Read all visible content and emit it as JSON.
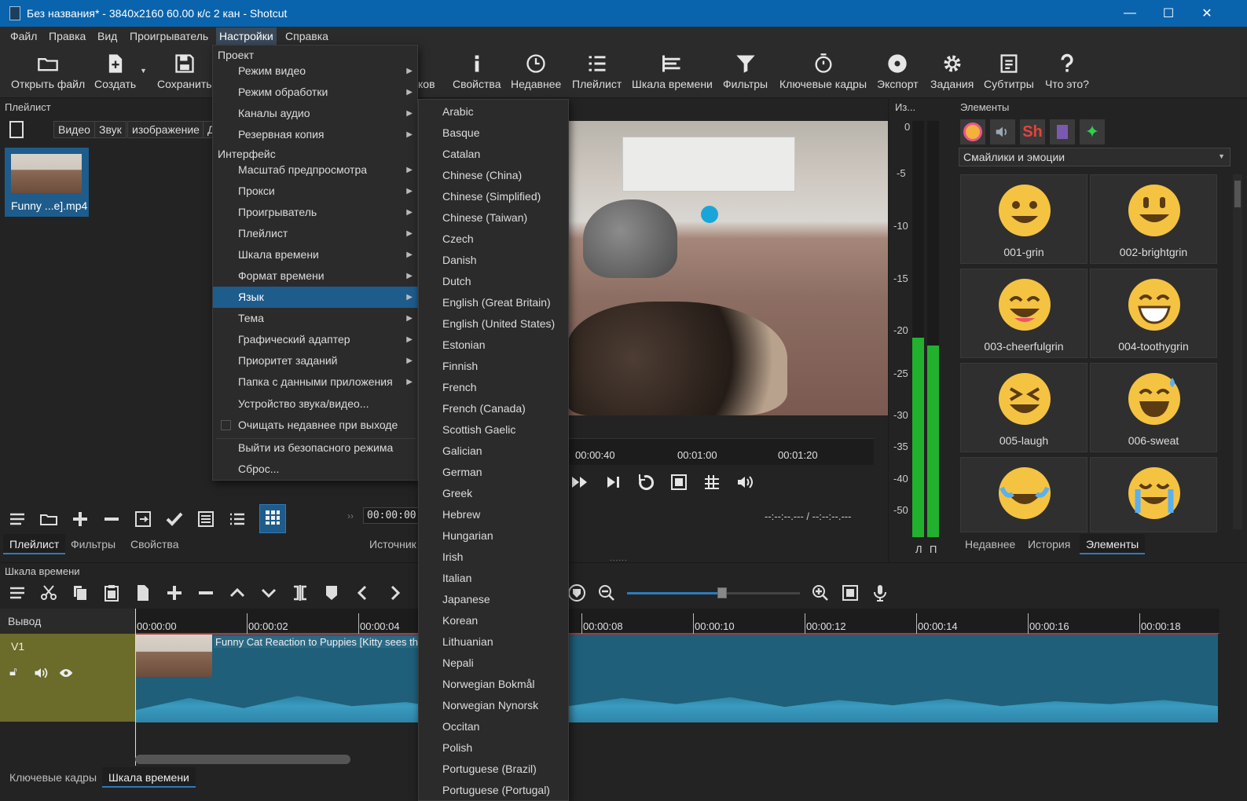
{
  "window": {
    "title": "Без названия* - 3840x2160 60.00 к/с 2 кан - Shotcut",
    "minimize": "—",
    "maximize": "☐",
    "close": "✕"
  },
  "menubar": [
    "Файл",
    "Правка",
    "Вид",
    "Проигрыватель",
    "Настройки",
    "Справка"
  ],
  "toolbar": {
    "open": "Открыть файл",
    "create": "Создать",
    "save": "Сохранить",
    "hidden_partial": "ков",
    "properties": "Свойства",
    "recent": "Недавнее",
    "playlist": "Плейлист",
    "timeline": "Шкала времени",
    "filters": "Фильтры",
    "keyframes": "Ключевые кадры",
    "export": "Экспорт",
    "jobs": "Задания",
    "subtitles": "Субтитры",
    "whatsthis": "Что это?"
  },
  "playlist": {
    "title": "Плейлист",
    "filters": [
      "Видео",
      "Звук",
      "изображение",
      "Д"
    ],
    "clip_label": "Funny ...e].mp4",
    "timecode": "00:00:00",
    "tabs": [
      "Плейлист",
      "Фильтры",
      "Свойства"
    ],
    "source_tab": "Источник"
  },
  "settings_menu": {
    "section_project": "Проект",
    "project_items": [
      "Режим видео",
      "Режим обработки",
      "Каналы аудио",
      "Резервная копия"
    ],
    "section_interface": "Интерфейс",
    "interface_items": [
      "Масштаб предпросмотра",
      "Прокси",
      "Проигрыватель",
      "Плейлист",
      "Шкала времени",
      "Формат времени",
      "Язык",
      "Тема",
      "Графический адаптер",
      "Приоритет заданий",
      "Папка с данными приложения"
    ],
    "device": "Устройство звука/видео...",
    "clear_recent": "Очищать недавнее при выходе",
    "safe_mode": "Выйти из безопасного режима",
    "reset": "Сброс..."
  },
  "languages": [
    "Arabic",
    "Basque",
    "Catalan",
    "Chinese (China)",
    "Chinese (Simplified)",
    "Chinese (Taiwan)",
    "Czech",
    "Danish",
    "Dutch",
    "English (Great Britain)",
    "English (United States)",
    "Estonian",
    "Finnish",
    "French",
    "French (Canada)",
    "Scottish Gaelic",
    "Galician",
    "German",
    "Greek",
    "Hebrew",
    "Hungarian",
    "Irish",
    "Italian",
    "Japanese",
    "Korean",
    "Lithuanian",
    "Nepali",
    "Norwegian Bokmål",
    "Norwegian Nynorsk",
    "Occitan",
    "Polish",
    "Portuguese (Brazil)",
    "Portuguese (Portugal)"
  ],
  "player": {
    "ruler": [
      "00:00:40",
      "00:01:00",
      "00:01:20"
    ],
    "time_display": "--:--:--.--- / --:--:--.---"
  },
  "meter": {
    "title": "Из...",
    "scale": [
      "0",
      "-5",
      "-10",
      "-15",
      "-20",
      "-25",
      "-30",
      "-35",
      "-40",
      "-50"
    ],
    "left": "Л",
    "right": "П",
    "left_level": 0.48,
    "right_level": 0.46
  },
  "elements": {
    "title": "Элементы",
    "category": "Смайлики и эмоции",
    "items": [
      "001-grin",
      "002-brightgrin",
      "003-cheerfulgrin",
      "004-toothygrin",
      "005-laugh",
      "006-sweat",
      "",
      ""
    ],
    "tabs": [
      "Недавнее",
      "История",
      "Элементы"
    ]
  },
  "timeline": {
    "title": "Шкала времени",
    "output": "Вывод",
    "track": "V1",
    "ruler": [
      "00:00:00",
      "00:00:02",
      "00:00:04",
      "00:00:08",
      "00:00:10",
      "00:00:12",
      "00:00:14",
      "00:00:16",
      "00:00:18"
    ],
    "clip_title": "Funny Cat Reaction to Puppies [Kitty sees them",
    "zoom_level": 0.55
  },
  "bottom_tabs": [
    "Ключевые кадры",
    "Шкала времени"
  ],
  "grip": "......",
  "colors": {
    "accent": "#1e5c8c",
    "titlebar": "#0a64ad",
    "track": "#6b6b2a",
    "clip": "#1f5f7a"
  }
}
